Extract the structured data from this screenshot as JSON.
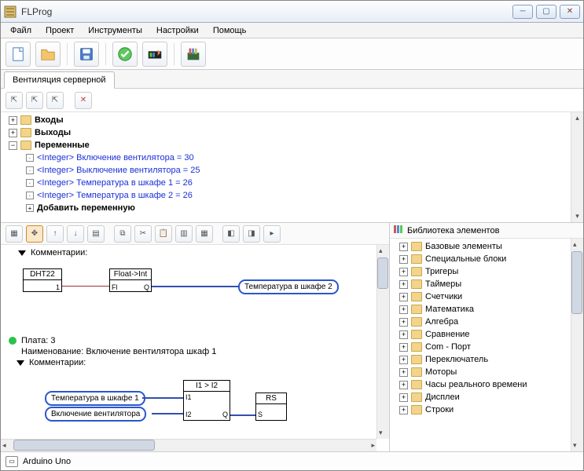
{
  "window": {
    "title": "FLProg"
  },
  "menu": {
    "file": "Файл",
    "project": "Проект",
    "tools": "Инструменты",
    "settings": "Настройки",
    "help": "Помощь"
  },
  "tab": {
    "label": "Вентиляция серверной"
  },
  "tree": {
    "inputs": "Входы",
    "outputs": "Выходы",
    "variables": "Переменные",
    "vars": [
      "<Integer> Включение вентилятора = 30",
      "<Integer> Выключение вентилятора = 25",
      "<Integer> Температура в шкафе 1 = 26",
      "<Integer> Температура в шкафе 2 = 26"
    ],
    "add_var": "Добавить переменную"
  },
  "canvas": {
    "comments_label": "Комментарии:",
    "dht_block": "DHT22",
    "float_block": "Float->Int",
    "float_in": "Fl",
    "float_out": "Q",
    "temp_oval": "Температура в шкафе 2",
    "plata_line": "Плата: 3",
    "naim_line": "Наименование: Включение вентилятора шкаф 1",
    "comments2": "Комментарии:",
    "temp1_oval": "Температура в шкафе 1",
    "vent_oval": "Включение вентилятора",
    "cmp_block": "I1 > I2",
    "cmp_i1": "I1",
    "cmp_i2": "I2",
    "cmp_q": "Q",
    "rs_block": "RS",
    "rs_s": "S"
  },
  "library": {
    "title": "Библиотека элементов",
    "items": [
      "Базовые элементы",
      "Специальные блоки",
      "Тригеры",
      "Таймеры",
      "Счетчики",
      "Математика",
      "Алгебра",
      "Сравнение",
      "Com - Порт",
      "Переключатель",
      "Моторы",
      "Часы реального времени",
      "Дисплеи",
      "Строки"
    ]
  },
  "status": {
    "board": "Arduino Uno"
  }
}
